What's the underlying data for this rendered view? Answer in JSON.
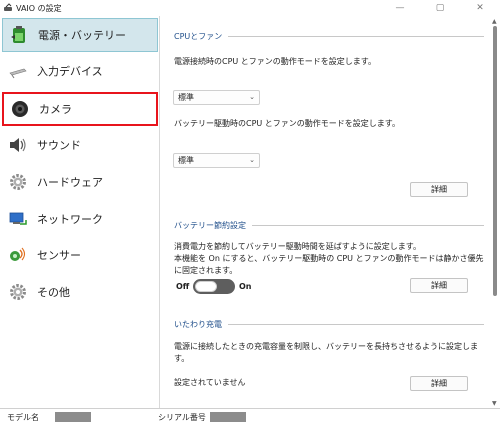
{
  "window": {
    "title": "VAIO の設定",
    "icon": "vaio-settings-icon",
    "controls": [
      "minimize-icon",
      "maximize-icon",
      "close-icon"
    ]
  },
  "sidebar": {
    "items": [
      {
        "label": "電源・バッテリー",
        "icon": "battery-icon",
        "state": "selected"
      },
      {
        "label": "入力デバイス",
        "icon": "stylus-icon"
      },
      {
        "label": "カメラ",
        "icon": "camera-icon",
        "state": "highlighted"
      },
      {
        "label": "サウンド",
        "icon": "speaker-icon"
      },
      {
        "label": "ハードウェア",
        "icon": "gear-icon"
      },
      {
        "label": "ネットワーク",
        "icon": "network-icon"
      },
      {
        "label": "センサー",
        "icon": "sensor-icon"
      },
      {
        "label": "その他",
        "icon": "gear-icon"
      }
    ]
  },
  "content": {
    "cpu_fan": {
      "title": "CPUとファン",
      "ac_desc": "電源接続時のCPU とファンの動作モードを設定します。",
      "ac_value": "標準",
      "battery_desc": "バッテリー駆動時のCPU とファンの動作モードを設定します。",
      "battery_value": "標準",
      "detail_label": "詳細"
    },
    "battery_saving": {
      "title": "バッテリー節約設定",
      "desc_line1": "消費電力を節約してバッテリー駆動時間を延ばすように設定します。",
      "desc_line2": "本機能を On にすると、バッテリー駆動時の CPU とファンの動作モードは静かさ優先",
      "desc_line3": "に固定されます。",
      "toggle_off_label": "Off",
      "toggle_on_label": "On",
      "toggle_state": "off",
      "detail_label": "詳細"
    },
    "care_charge": {
      "title": "いたわり充電",
      "desc_line1": "電源に接続したときの充電容量を制限し、バッテリーを長持ちさせるように設定しま",
      "desc_line2": "す。",
      "status": "設定されていません",
      "detail_label": "詳細"
    }
  },
  "statusbar": {
    "model_label": "モデル名",
    "serial_label": "シリアル番号"
  },
  "colors": {
    "selected_bg": "#d3e6ec",
    "highlight_border": "#e8141c",
    "section_title": "#1f4e8a",
    "toggle_track": "#5e5e5e"
  }
}
